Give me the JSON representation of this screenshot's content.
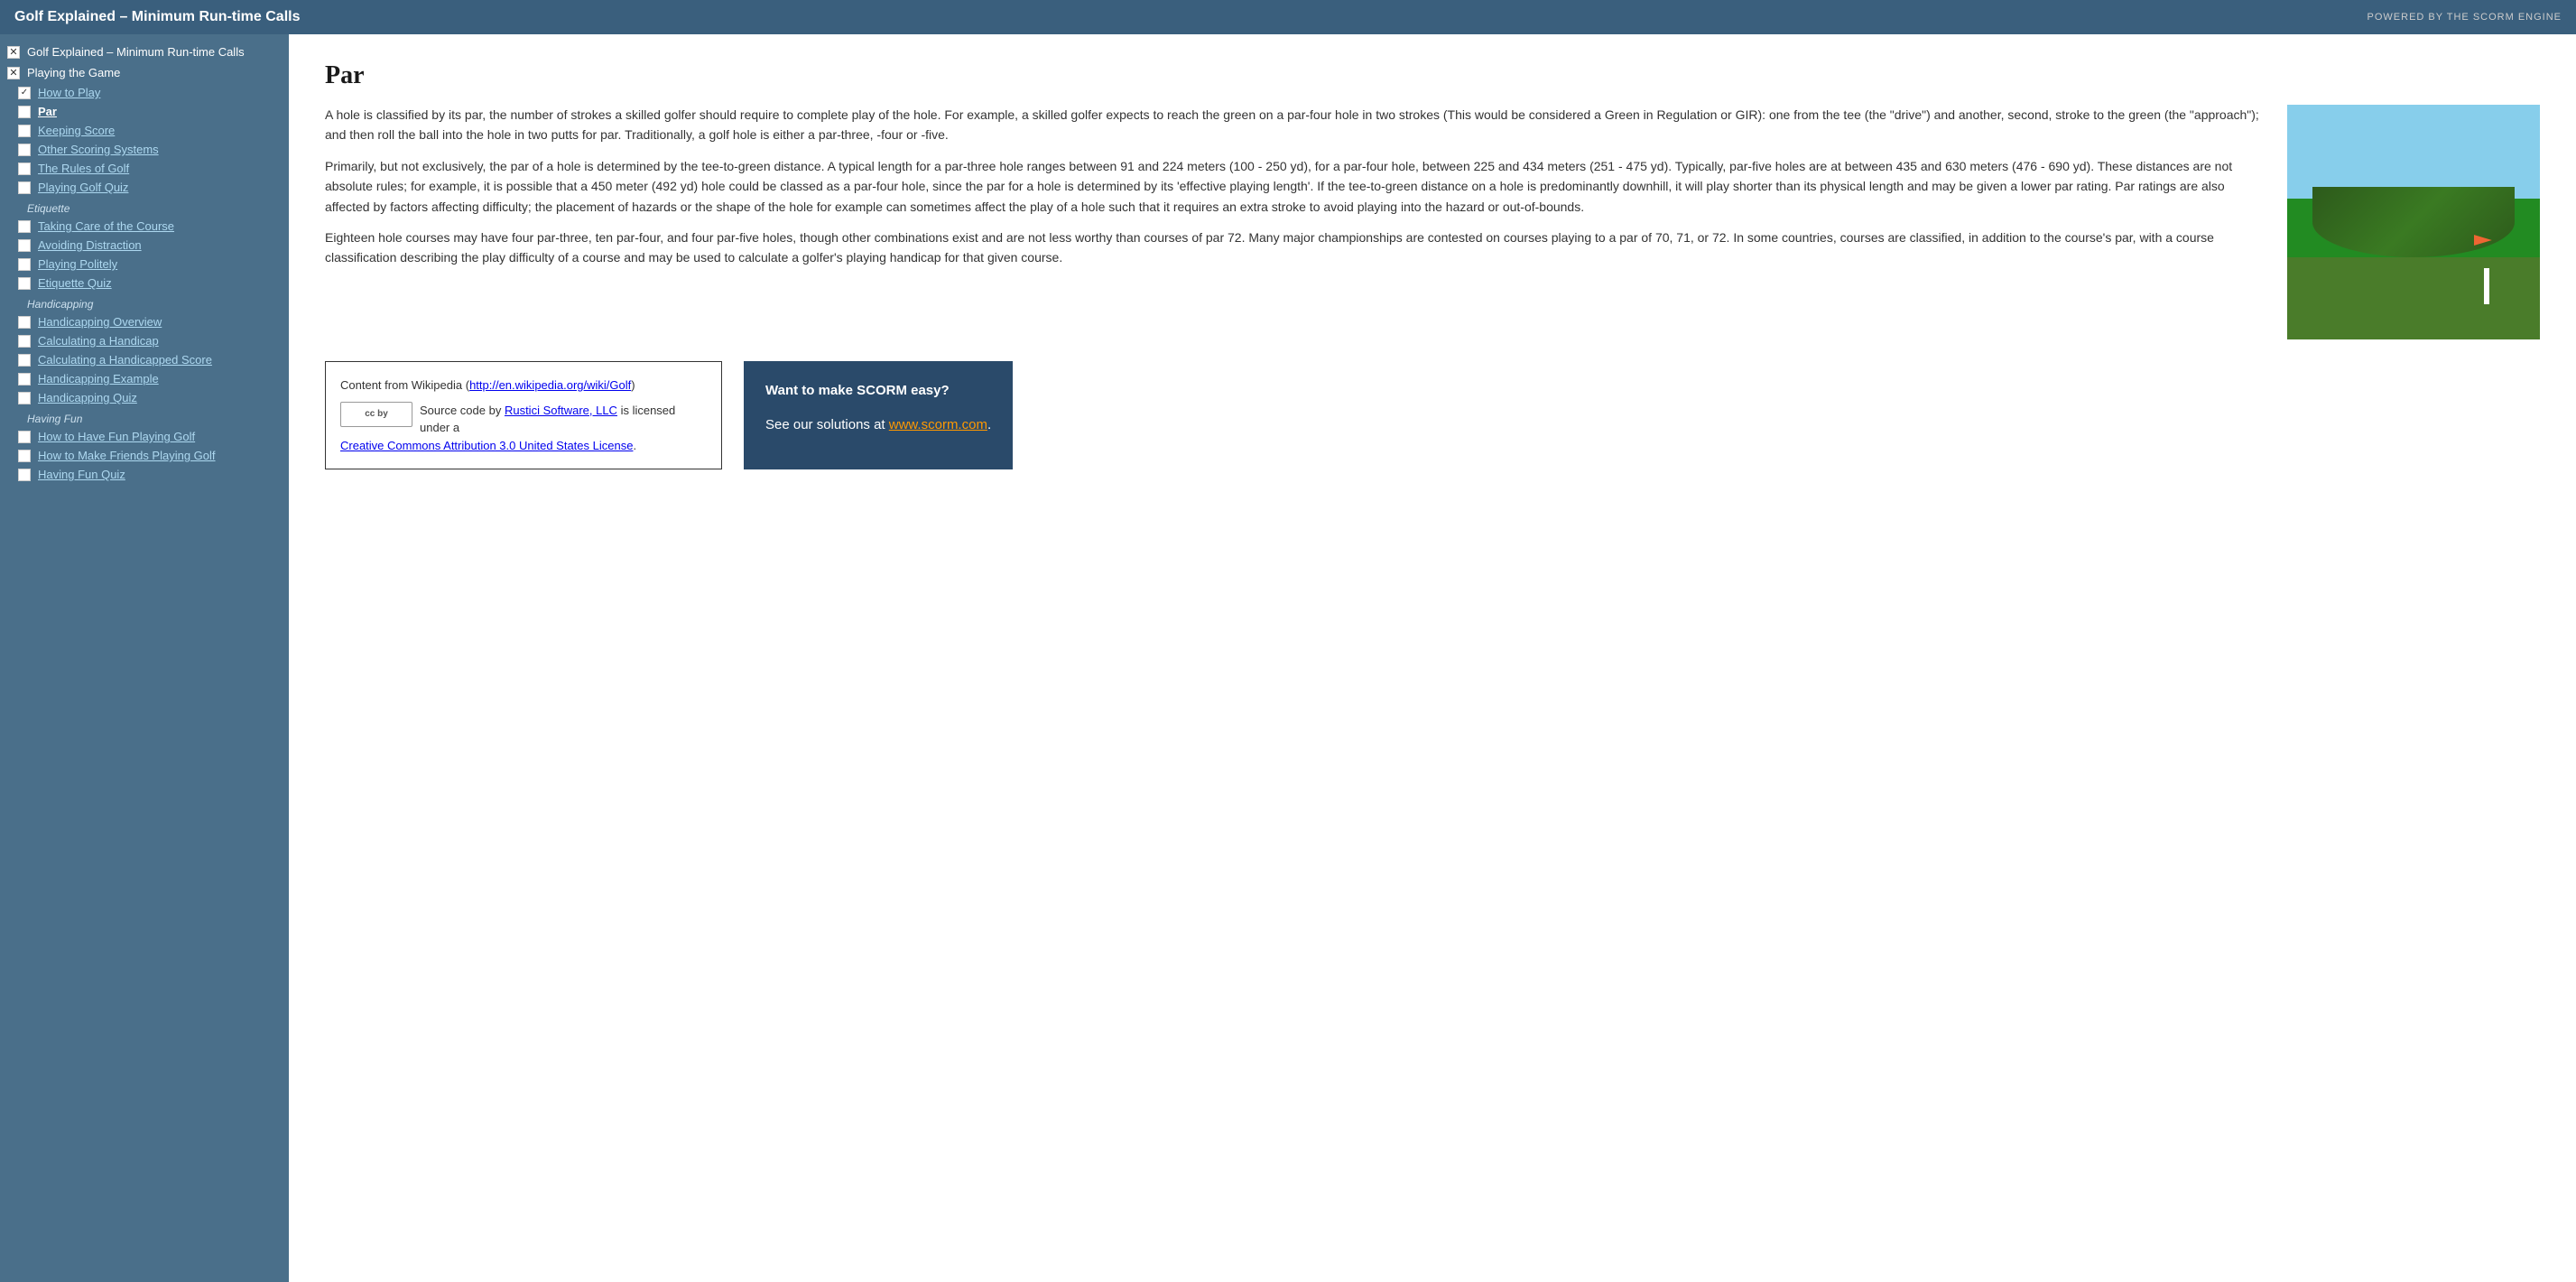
{
  "header": {
    "title": "Golf Explained – Minimum Run-time Calls",
    "powered_by": "POWERED BY THE SCORM ENGINE"
  },
  "sidebar": {
    "root_item": {
      "label": "Golf Explained – Minimum Run-time Calls",
      "status": "x"
    },
    "sections": [
      {
        "name": "Playing the Game",
        "status": "x",
        "items": [
          {
            "label": "How to Play",
            "status": "checked",
            "active": false
          },
          {
            "label": "Par",
            "status": "empty",
            "active": true
          },
          {
            "label": "Keeping Score",
            "status": "empty",
            "active": false
          },
          {
            "label": "Other Scoring Systems",
            "status": "empty",
            "active": false
          },
          {
            "label": "The Rules of Golf",
            "status": "empty",
            "active": false
          },
          {
            "label": "Playing Golf Quiz",
            "status": "empty",
            "active": false
          }
        ]
      },
      {
        "name": "Etiquette",
        "status": "empty",
        "items": [
          {
            "label": "Taking Care of the Course",
            "status": "empty",
            "active": false
          },
          {
            "label": "Avoiding Distraction",
            "status": "empty",
            "active": false
          },
          {
            "label": "Playing Politely",
            "status": "empty",
            "active": false
          },
          {
            "label": "Etiquette Quiz",
            "status": "empty",
            "active": false
          }
        ]
      },
      {
        "name": "Handicapping",
        "status": "empty",
        "items": [
          {
            "label": "Handicapping Overview",
            "status": "empty",
            "active": false
          },
          {
            "label": "Calculating a Handicap",
            "status": "empty",
            "active": false
          },
          {
            "label": "Calculating a Handicapped Score",
            "status": "empty",
            "active": false
          },
          {
            "label": "Handicapping Example",
            "status": "empty",
            "active": false
          },
          {
            "label": "Handicapping Quiz",
            "status": "empty",
            "active": false
          }
        ]
      },
      {
        "name": "Having Fun",
        "status": "empty",
        "items": [
          {
            "label": "How to Have Fun Playing Golf",
            "status": "empty",
            "active": false
          },
          {
            "label": "How to Make Friends Playing Golf",
            "status": "empty",
            "active": false
          },
          {
            "label": "Having Fun Quiz",
            "status": "empty",
            "active": false
          }
        ]
      }
    ]
  },
  "main": {
    "title": "Par",
    "paragraphs": [
      "A hole is classified by its par, the number of strokes a skilled golfer should require to complete play of the hole. For example, a skilled golfer expects to reach the green on a par-four hole in two strokes (This would be considered a Green in Regulation or GIR): one from the tee (the \"drive\") and another, second, stroke to the green (the \"approach\"); and then roll the ball into the hole in two putts for par. Traditionally, a golf hole is either a par-three, -four or -five.",
      "Primarily, but not exclusively, the par of a hole is determined by the tee-to-green distance. A typical length for a par-three hole ranges between 91 and 224 meters (100 - 250 yd), for a par-four hole, between 225 and 434 meters (251 - 475 yd). Typically, par-five holes are at between 435 and 630 meters (476 - 690 yd). These distances are not absolute rules; for example, it is possible that a 450 meter (492 yd) hole could be classed as a par-four hole, since the par for a hole is determined by its 'effective playing length'. If the tee-to-green distance on a hole is predominantly downhill, it will play shorter than its physical length and may be given a lower par rating. Par ratings are also affected by factors affecting difficulty; the placement of hazards or the shape of the hole for example can sometimes affect the play of a hole such that it requires an extra stroke to avoid playing into the hazard or out-of-bounds.",
      "Eighteen hole courses may have four par-three, ten par-four, and four par-five holes, though other combinations exist and are not less worthy than courses of par 72. Many major championships are contested on courses playing to a par of 70, 71, or 72. In some countries, courses are classified, in addition to the course's par, with a course classification describing the play difficulty of a course and may be used to calculate a golfer's playing handicap for that given course."
    ]
  },
  "wikipedia_box": {
    "text_before": "Content from Wikipedia (",
    "link_text": "http://en.wikipedia.org/wiki/Golf",
    "link_url": "http://en.wikipedia.org/wiki/Golf",
    "text_after": ")",
    "cc_label": "cc by",
    "source_text": " Source code by ",
    "source_link_text": "Rustici Software, LLC",
    "source_link_url": "#",
    "license_text": " is licensed under a ",
    "license_link_text": "Creative Commons Attribution 3.0 United States License",
    "license_link_url": "#",
    "period": "."
  },
  "scorm_box": {
    "line1": "Want to make SCORM easy?",
    "line2_prefix": "See our solutions at ",
    "link_text": "www.scorm.com",
    "link_url": "http://www.scorm.com",
    "line2_suffix": "."
  }
}
